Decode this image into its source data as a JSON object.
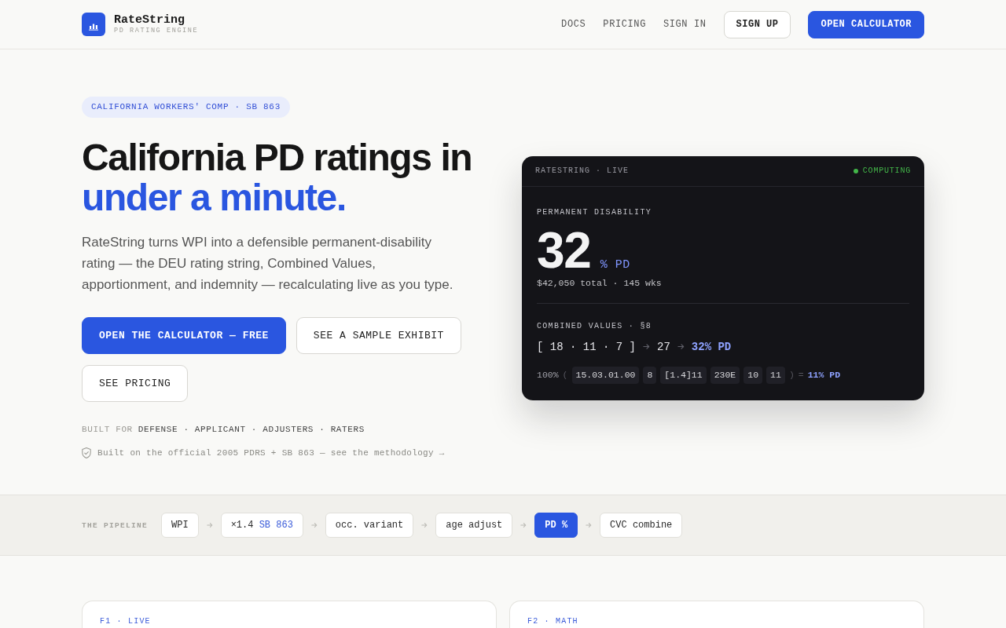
{
  "header": {
    "logo": {
      "name": "RateString",
      "tagline": "PD RATING ENGINE"
    },
    "nav_links": [
      "DOCS",
      "PRICING",
      "SIGN IN"
    ],
    "buttons": [
      {
        "label": "SIGN UP",
        "kind": "outline"
      },
      {
        "label": "OPEN CALCULATOR",
        "kind": "primary"
      }
    ]
  },
  "hero": {
    "badge": "CALIFORNIA WORKERS' COMP · SB 863",
    "headline": "California PD ratings in",
    "headline_accent": "under a minute.",
    "lede": "RateString turns WPI into a defensible permanent-disability rating — the DEU rating string, Combined Values, apportionment, and indemnity — recalculating live as you type.",
    "buttons": [
      {
        "label": "OPEN THE CALCULATOR — FREE",
        "kind": "primary"
      },
      {
        "label": "SEE A SAMPLE EXHIBIT",
        "kind": "outline"
      },
      {
        "label": "SEE PRICING",
        "kind": "outline"
      }
    ],
    "audience": {
      "label": "BUILT FOR",
      "groups": "DEFENSE · APPLICANT · ADJUSTERS · RATERS"
    },
    "trust_note": "Built on the official 2005 PDRS + SB 863 — see the methodology →"
  },
  "live_card": {
    "title": "RATESTRING · LIVE",
    "status": {
      "label": "COMPUTING",
      "color": "#43b649"
    },
    "metric_label": "PERMANENT DISABILITY",
    "metric_value": "32",
    "metric_unit": "% PD",
    "metric_detail": "$42,050 total · 145 wks",
    "combined": {
      "label": "COMBINED VALUES · §8",
      "inputs": "[ 18 · 11 · 7 ]",
      "sum": "27",
      "result": "32% PD"
    },
    "rating_string": {
      "apportionment": "100%",
      "open": "(",
      "segments": [
        "15.03.01.00",
        "8",
        "[1.4]11",
        "230E",
        "10",
        "11"
      ],
      "close": ")",
      "equals": "=",
      "result": "11% PD"
    }
  },
  "pipeline": {
    "label": "THE PIPELINE",
    "steps": [
      {
        "label": "WPI",
        "selected": false
      },
      {
        "label": "×1.4",
        "note": "SB 863",
        "selected": false
      },
      {
        "label": "occ. variant",
        "selected": false
      },
      {
        "label": "age adjust",
        "selected": false
      },
      {
        "label": "PD %",
        "selected": true
      },
      {
        "label": "CVC combine",
        "selected": false
      }
    ]
  },
  "features": [
    "F1 · LIVE",
    "F2 · MATH"
  ]
}
